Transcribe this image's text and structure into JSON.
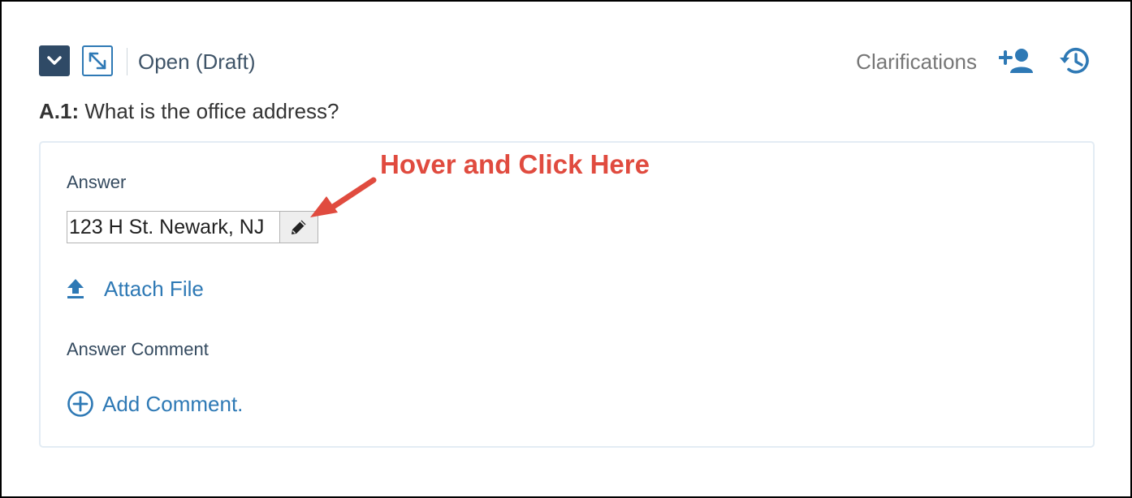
{
  "header": {
    "status": "Open (Draft)",
    "clarifications_label": "Clarifications"
  },
  "question": {
    "id": "A.1:",
    "text": "What is the office address?"
  },
  "answer": {
    "label": "Answer",
    "value": "123 H St. Newark, NJ"
  },
  "attach": {
    "label": "Attach File"
  },
  "comment": {
    "label": "Answer Comment",
    "add_label": "Add Comment."
  },
  "annotation": {
    "text": "Hover and Click Here",
    "color": "#e04b3f"
  },
  "colors": {
    "accent": "#2e79b5",
    "dark_button": "#2f4a66",
    "label_text": "#344a5f"
  },
  "icons": {
    "collapse": "chevron-down-icon",
    "expand": "expand-icon",
    "add_user": "add-user-icon",
    "history": "history-icon",
    "edit": "pencil-icon",
    "upload": "upload-icon",
    "add_comment": "plus-circle-icon"
  }
}
